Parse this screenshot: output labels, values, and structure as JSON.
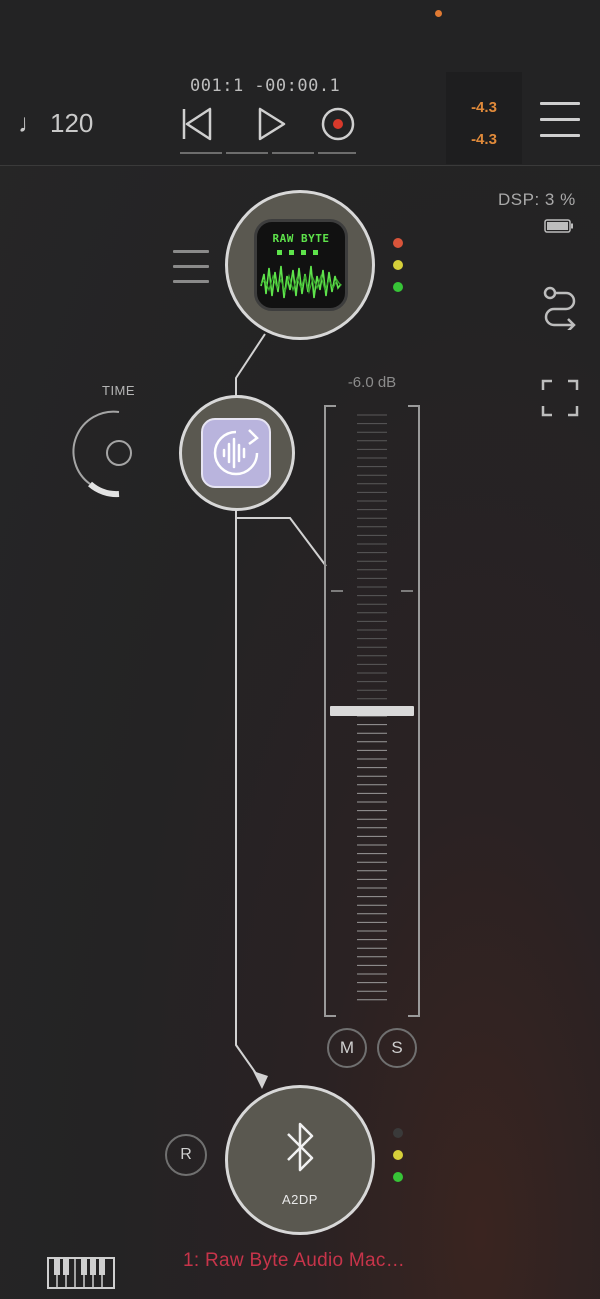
{
  "header": {
    "tempo": "120",
    "tempo_icon": "music-note-icon",
    "timecode": "001:1 -00:00.1",
    "meter": {
      "left": "-4.3",
      "right": "-4.3"
    },
    "accent": "#e08a3a",
    "notification_color": "#e07a33"
  },
  "status": {
    "dsp": "DSP:  3 %"
  },
  "chain": {
    "instrument": {
      "name": "RAW BYTE",
      "leds": [
        "#d9543a",
        "#d6cf3a",
        "#37c437"
      ]
    },
    "effect": {
      "icon": "audio-loop-icon",
      "time_label": "TIME"
    },
    "output": {
      "name": "A2DP",
      "icon": "bluetooth-icon",
      "leds": [
        "#3a3a3a",
        "#d6cf3a",
        "#37c437"
      ]
    }
  },
  "fader": {
    "db_label": "-6.0 dB",
    "mute_label": "M",
    "solo_label": "S"
  },
  "record_arm_label": "R",
  "footer": {
    "device_name": "1: Raw Byte Audio Mac…"
  }
}
